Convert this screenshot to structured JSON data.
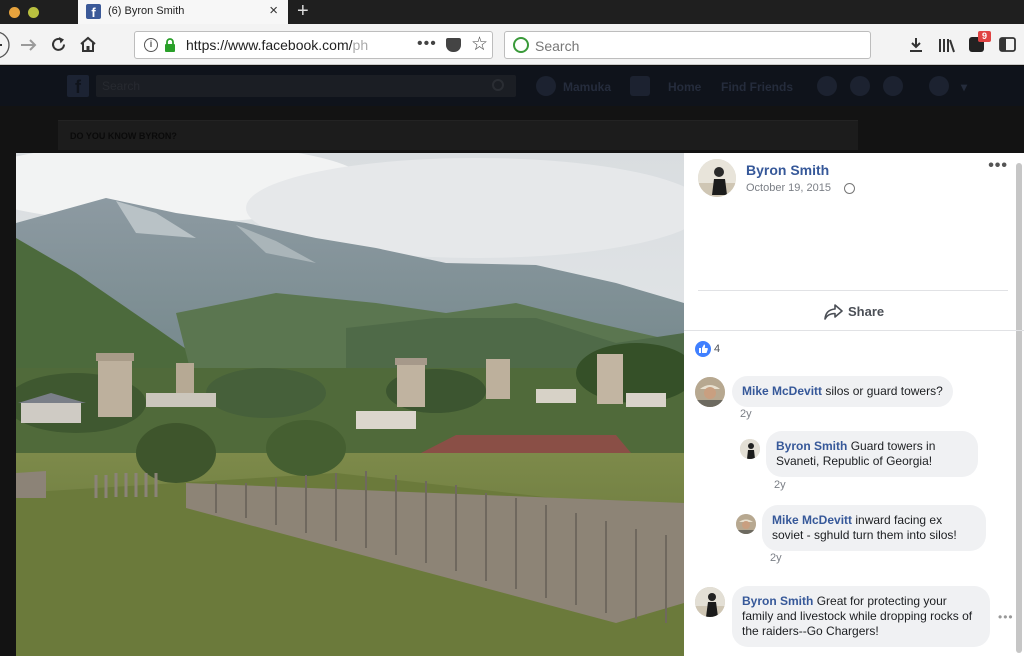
{
  "browser": {
    "tab_title": "(6) Byron Smith",
    "favicon": "f",
    "url_main": "https://www.facebook.com/",
    "url_fade": "ph",
    "search_placeholder": "Search",
    "badge_count": "9",
    "icons": [
      "back-icon",
      "forward-icon",
      "reload-icon",
      "home-icon",
      "info-icon",
      "lock-icon",
      "more-icon",
      "pocket-icon",
      "star-icon",
      "download-icon",
      "library-icon",
      "extension-icon",
      "sidebar-icon"
    ]
  },
  "facebook_bar": {
    "search_placeholder": "Search",
    "user": "Mamuka",
    "nav": [
      "Home",
      "Find Friends"
    ]
  },
  "background": {
    "section_title": "DO YOU KNOW BYRON?"
  },
  "post": {
    "author": "Byron Smith",
    "date": "October 19, 2015",
    "share_label": "Share",
    "likes": "4"
  },
  "comments": [
    {
      "name": "Mike McDevitt",
      "text": "silos or guard towers?",
      "time": "2y"
    },
    {
      "name": "Byron Smith",
      "text": "Guard towers in Svaneti, Republic of Georgia!",
      "time": "2y"
    },
    {
      "name": "Mike McDevitt",
      "text": "inward facing ex soviet - sghuld turn them into silos!",
      "time": "2y"
    },
    {
      "name": "Byron Smith",
      "text": "Great for protecting your family and livestock while dropping rocks of the raiders--Go Chargers!",
      "time": ""
    }
  ],
  "colors": {
    "link": "#365899",
    "like_blue": "#4080ff",
    "bubble": "#f0f1f3"
  }
}
